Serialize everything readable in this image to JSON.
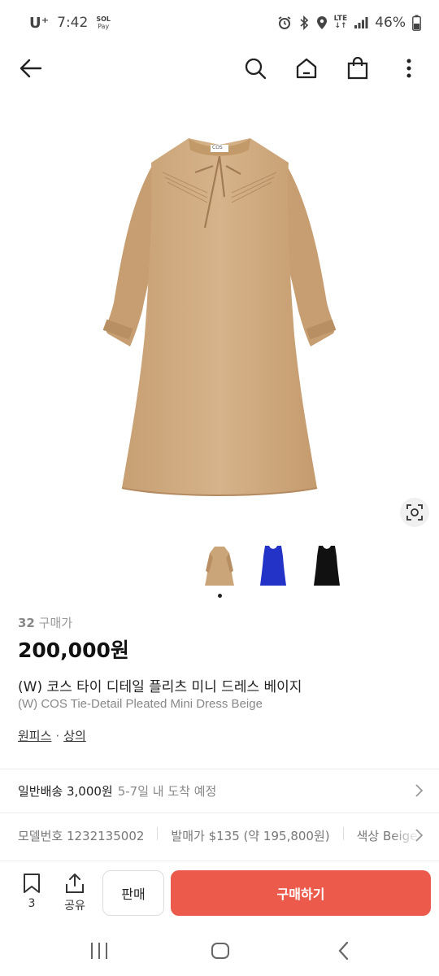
{
  "status_bar": {
    "carrier": "U⁺",
    "time": "7:42",
    "sol_pay_top": "SOL",
    "sol_pay_bottom": "Pay",
    "network": "LTE",
    "battery": "46%"
  },
  "product": {
    "purchase_count": "32",
    "purchase_label": "구매가",
    "price": "200,000원",
    "title_ko": "(W) 코스 타이 디테일 플리츠 미니 드레스 베이지",
    "title_en": "(W) COS Tie-Detail Pleated Mini Dress Beige",
    "category_1": "원피스",
    "category_sep": "·",
    "category_2": "상의",
    "brand_tag": "COS"
  },
  "thumbnails": [
    {
      "color": "#c9a57c",
      "label": "beige"
    },
    {
      "color": "#2536c9",
      "label": "blue"
    },
    {
      "color": "#111111",
      "label": "black"
    }
  ],
  "shipping": {
    "main": "일반배송 3,000원",
    "sub": "5-7일 내 도착 예정"
  },
  "info": {
    "model": "모델번호 1232135002",
    "release_price": "발매가 $135 (약 195,800원)",
    "color": "색상 Beige"
  },
  "actions": {
    "bookmark_count": "3",
    "share_label": "공유",
    "sell_label": "판매",
    "buy_label": "구매하기"
  },
  "colors": {
    "accent": "#ec5a4c",
    "dress": "#d2ad82"
  }
}
